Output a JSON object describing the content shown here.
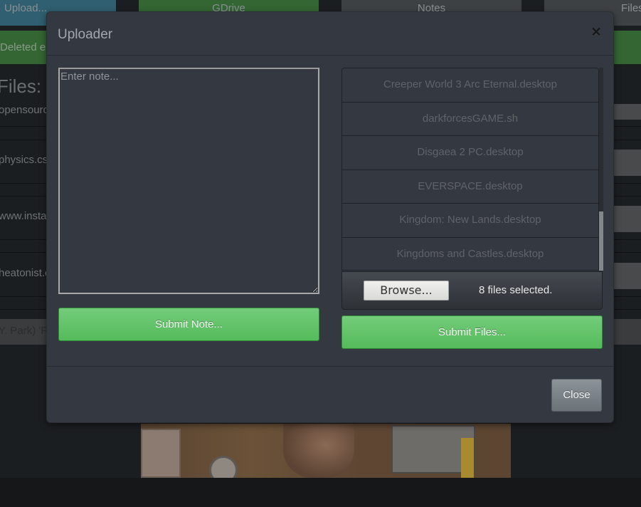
{
  "background": {
    "nav": {
      "upload": "Upload...",
      "gdrive": "GDrive",
      "notes": "Notes",
      "files": "Files"
    },
    "alert_text": "Deleted en",
    "files_heading": "Files:",
    "file_rows": [
      "opensourc",
      "physics.cs",
      "www.instag",
      "heatonist.c",
      "Y. Park) 'F"
    ]
  },
  "modal": {
    "title": "Uploader",
    "close_icon": "close-x-icon",
    "note": {
      "placeholder": "Enter note...",
      "value": ""
    },
    "submit_note_label": "Submit Note...",
    "selected_files": [
      "Creeper World 3 Arc Eternal.desktop",
      "darkforcesGAME.sh",
      "Disgaea 2 PC.desktop",
      "EVERSPACE.desktop",
      "Kingdom: New Lands.desktop",
      "Kingdoms and Castles.desktop"
    ],
    "browse_label": "Browse...",
    "files_selected_text": "8 files selected.",
    "submit_files_label": "Submit Files...",
    "close_label": "Close"
  },
  "colors": {
    "success_green": "#5cb85c",
    "nav_upload": "#2f5f70",
    "nav_gdrive": "#336633",
    "modal_bg": "#343840"
  }
}
